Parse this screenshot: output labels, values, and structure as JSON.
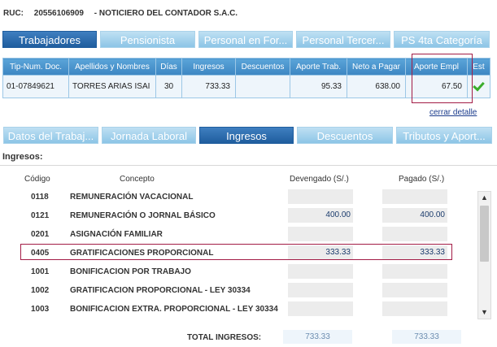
{
  "header": {
    "ruc_label": "RUC:",
    "ruc_number": "20556106909",
    "dash": "-",
    "company": "NOTICIERO DEL CONTADOR S.A.C."
  },
  "top_tabs": [
    {
      "label": "Trabajadores"
    },
    {
      "label": "Pensionista"
    },
    {
      "label": "Personal en For..."
    },
    {
      "label": "Personal Tercer..."
    },
    {
      "label": "PS 4ta Categoría"
    }
  ],
  "workers_table": {
    "columns": [
      "Tip-Num. Doc.",
      "Apellidos y Nombres",
      "Días",
      "Ingresos",
      "Descuentos",
      "Aporte Trab.",
      "Neto a Pagar",
      "Aporte Empl",
      "Est"
    ],
    "row": {
      "doc": "01-07849621",
      "name": "TORRES ARIAS ISAI",
      "days": "30",
      "income": "733.33",
      "discounts": "",
      "worker_contribution": "95.33",
      "net_pay": "638.00",
      "employer_contribution": "67.50",
      "status_icon": "check-icon"
    }
  },
  "close_detail": "cerrar detalle",
  "sub_tabs": [
    {
      "label": "Datos del Trabaj..."
    },
    {
      "label": "Jornada Laboral"
    },
    {
      "label": "Ingresos"
    },
    {
      "label": "Descuentos"
    },
    {
      "label": "Tributos y Aport..."
    }
  ],
  "ingresos": {
    "title": "Ingresos:",
    "headers": {
      "code": "Código",
      "concept": "Concepto",
      "accrued": "Devengado (S/.)",
      "paid": "Pagado (S/.)"
    },
    "rows": [
      {
        "code": "0118",
        "concept": "REMUNERACIÓN VACACIONAL",
        "accrued": "",
        "paid": ""
      },
      {
        "code": "0121",
        "concept": "REMUNERACIÓN O JORNAL BÁSICO",
        "accrued": "400.00",
        "paid": "400.00"
      },
      {
        "code": "0201",
        "concept": "ASIGNACIÓN FAMILIAR",
        "accrued": "",
        "paid": ""
      },
      {
        "code": "0405",
        "concept": "GRATIFICACIONES PROPORCIONAL",
        "accrued": "333.33",
        "paid": "333.33"
      },
      {
        "code": "1001",
        "concept": "BONIFICACION POR TRABAJO",
        "accrued": "",
        "paid": ""
      },
      {
        "code": "1002",
        "concept": "GRATIFICACION PROPORCIONAL - LEY 30334",
        "accrued": "",
        "paid": ""
      },
      {
        "code": "1003",
        "concept": "BONIFICACION EXTRA. PROPORCIONAL - LEY 30334",
        "accrued": "",
        "paid": ""
      }
    ],
    "total_label": "TOTAL INGRESOS:",
    "total_accrued": "733.33",
    "total_paid": "733.33"
  },
  "colors": {
    "active_tab": "#1f5d9e",
    "inactive_tab": "#8cc5e6",
    "highlight": "#a31c46",
    "check": "#3cad2c"
  }
}
